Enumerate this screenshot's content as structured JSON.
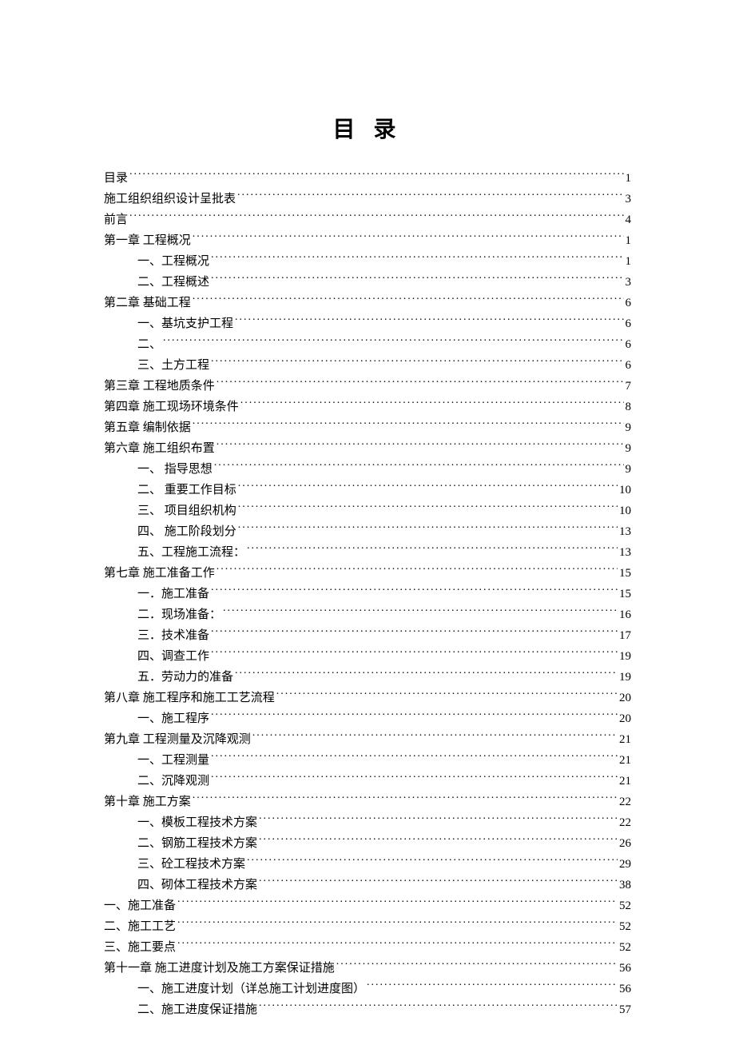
{
  "title": "目 录",
  "toc": [
    {
      "level": 1,
      "label": "目录",
      "page": "1"
    },
    {
      "level": 1,
      "label": "施工组织组织设计呈批表",
      "page": "3"
    },
    {
      "level": 1,
      "label": "前言",
      "page": "4"
    },
    {
      "level": 1,
      "label": "第一章  工程概况",
      "page": "1"
    },
    {
      "level": 2,
      "label": "一、工程概况",
      "page": "1"
    },
    {
      "level": 2,
      "label": "二、工程概述",
      "page": "3"
    },
    {
      "level": 1,
      "label": "第二章  基础工程",
      "page": "6"
    },
    {
      "level": 2,
      "label": "一、基坑支护工程",
      "page": "6"
    },
    {
      "level": 2,
      "label": "二、",
      "page": "6"
    },
    {
      "level": 2,
      "label": "三、土方工程",
      "page": "6"
    },
    {
      "level": 1,
      "label": "第三章  工程地质条件",
      "page": "7"
    },
    {
      "level": 1,
      "label": "第四章   施工现场环境条件",
      "page": "8"
    },
    {
      "level": 1,
      "label": "第五章  编制依据",
      "page": "9"
    },
    {
      "level": 1,
      "label": "第六章  施工组织布置",
      "page": "9"
    },
    {
      "level": 2,
      "label": "一、  指导思想",
      "page": "9"
    },
    {
      "level": 2,
      "label": "二、  重要工作目标",
      "page": "10"
    },
    {
      "level": 2,
      "label": "三、  项目组织机构",
      "page": "10"
    },
    {
      "level": 2,
      "label": "四、 施工阶段划分",
      "page": "13"
    },
    {
      "level": 2,
      "label": "五、工程施工流程：",
      "page": "13"
    },
    {
      "level": 1,
      "label": "第七章  施工准备工作",
      "page": "15"
    },
    {
      "level": 2,
      "label": "一．施工准备",
      "page": "15"
    },
    {
      "level": 2,
      "label": "二．现场准备：",
      "page": "16"
    },
    {
      "level": 2,
      "label": "三．技术准备",
      "page": "17"
    },
    {
      "level": 2,
      "label": "四、调查工作",
      "page": "19"
    },
    {
      "level": 2,
      "label": "五．劳动力的准备",
      "page": "19"
    },
    {
      "level": 1,
      "label": "第八章  施工程序和施工工艺流程",
      "page": "20"
    },
    {
      "level": 2,
      "label": "一、施工程序",
      "page": "20"
    },
    {
      "level": 1,
      "label": "第九章  工程测量及沉降观测",
      "page": "21"
    },
    {
      "level": 2,
      "label": "一、工程测量",
      "page": "21"
    },
    {
      "level": 2,
      "label": "二、沉降观测",
      "page": "21"
    },
    {
      "level": 1,
      "label": "第十章    施工方案",
      "page": "22"
    },
    {
      "level": 2,
      "label": "一、模板工程技术方案",
      "page": "22"
    },
    {
      "level": 2,
      "label": "二、钢筋工程技术方案",
      "page": "26"
    },
    {
      "level": 2,
      "label": "三、砼工程技术方案",
      "page": "29"
    },
    {
      "level": 2,
      "label": "四、砌体工程技术方案",
      "page": "38"
    },
    {
      "level": 1,
      "label": "一、施工准备",
      "page": "52"
    },
    {
      "level": 1,
      "label": "二、施工工艺",
      "page": "52"
    },
    {
      "level": 1,
      "label": "三、施工要点",
      "page": "52"
    },
    {
      "level": 1,
      "label": "第十一章  施工进度计划及施工方案保证措施",
      "page": "56"
    },
    {
      "level": 2,
      "label": "一、施工进度计划（详总施工计划进度图）",
      "page": "56"
    },
    {
      "level": 2,
      "label": "二、施工进度保证措施",
      "page": "57"
    }
  ]
}
